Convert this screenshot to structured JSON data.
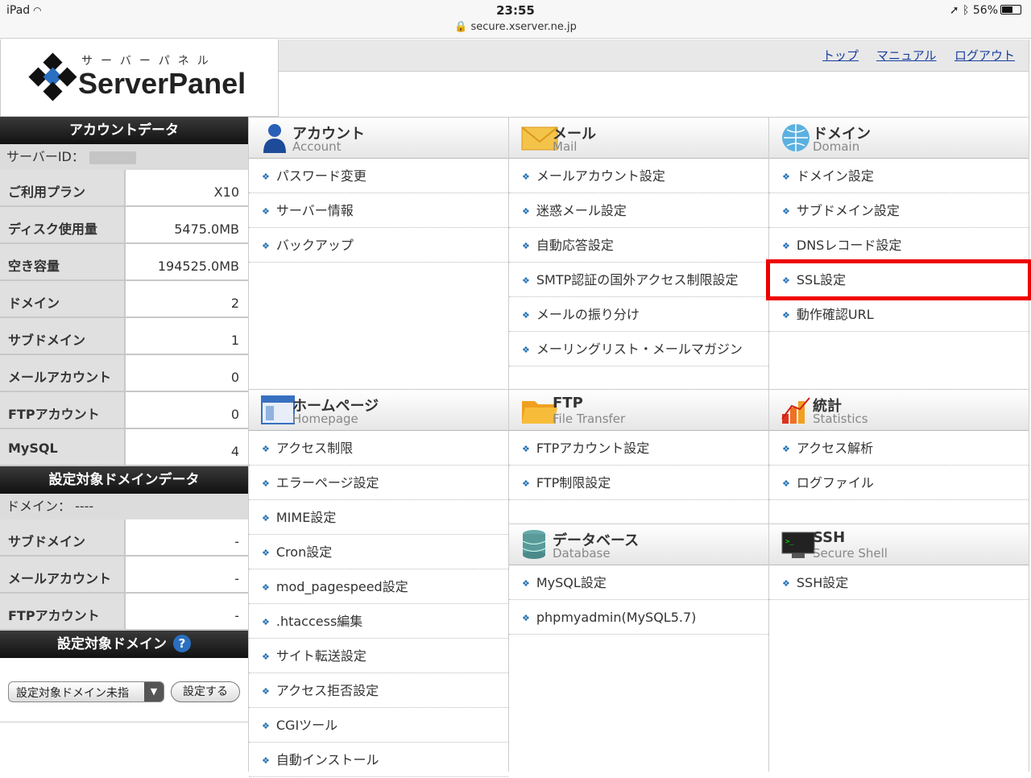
{
  "status_bar": {
    "device": "iPad",
    "time": "23:55",
    "url": "secure.xserver.ne.jp",
    "battery": "56%",
    "battery_level": 0.56
  },
  "logo": {
    "kana": "サーバーパネル",
    "brand": "ServerPanel"
  },
  "top_links": [
    "トップ",
    "マニュアル",
    "ログアウト"
  ],
  "sidebar": {
    "account_title": "アカウントデータ",
    "server_id_label": "サーバーID：",
    "account_rows": [
      {
        "label": "ご利用プラン",
        "value": "X10"
      },
      {
        "label": "ディスク使用量",
        "value": "5475.0MB"
      },
      {
        "label": "空き容量",
        "value": "194525.0MB"
      },
      {
        "label": "ドメイン",
        "value": "2"
      },
      {
        "label": "サブドメイン",
        "value": "1"
      },
      {
        "label": "メールアカウント",
        "value": "0"
      },
      {
        "label": "FTPアカウント",
        "value": "0"
      },
      {
        "label": "MySQL",
        "value": "4"
      }
    ],
    "domain_data_title": "設定対象ドメインデータ",
    "domain_label": "ドメイン：",
    "domain_value": "----",
    "domain_rows": [
      {
        "label": "サブドメイン",
        "value": "-"
      },
      {
        "label": "メールアカウント",
        "value": "-"
      },
      {
        "label": "FTPアカウント",
        "value": "-"
      }
    ],
    "target_title": "設定対象ドメイン",
    "help_icon": "?",
    "select_value": "設定対象ドメイン未指",
    "set_button": "設定する"
  },
  "sections": {
    "account": {
      "jp": "アカウント",
      "en": "Account",
      "items": [
        "パスワード変更",
        "サーバー情報",
        "バックアップ"
      ]
    },
    "mail": {
      "jp": "メール",
      "en": "Mail",
      "items": [
        "メールアカウント設定",
        "迷惑メール設定",
        "自動応答設定",
        "SMTP認証の国外アクセス制限設定",
        "メールの振り分け",
        "メーリングリスト・メールマガジン"
      ]
    },
    "domain": {
      "jp": "ドメイン",
      "en": "Domain",
      "items": [
        "ドメイン設定",
        "サブドメイン設定",
        "DNSレコード設定",
        "SSL設定",
        "動作確認URL"
      ]
    },
    "homepage": {
      "jp": "ホームページ",
      "en": "Homepage",
      "items": [
        "アクセス制限",
        "エラーページ設定",
        "MIME設定",
        "Cron設定",
        "mod_pagespeed設定",
        ".htaccess編集",
        "サイト転送設定",
        "アクセス拒否設定",
        "CGIツール",
        "自動インストール"
      ]
    },
    "ftp": {
      "jp": "FTP",
      "en": "File Transfer",
      "items": [
        "FTPアカウント設定",
        "FTP制限設定"
      ]
    },
    "stats": {
      "jp": "統計",
      "en": "Statistics",
      "items": [
        "アクセス解析",
        "ログファイル"
      ]
    },
    "database": {
      "jp": "データベース",
      "en": "Database",
      "items": [
        "MySQL設定",
        "phpmyadmin(MySQL5.7)"
      ]
    },
    "ssh": {
      "jp": "SSH",
      "en": "Secure Shell",
      "items": [
        "SSH設定"
      ]
    }
  },
  "colors": {
    "link": "#1a3fa0",
    "highlight": "#e00000",
    "bullet": "#1f6fb5"
  }
}
